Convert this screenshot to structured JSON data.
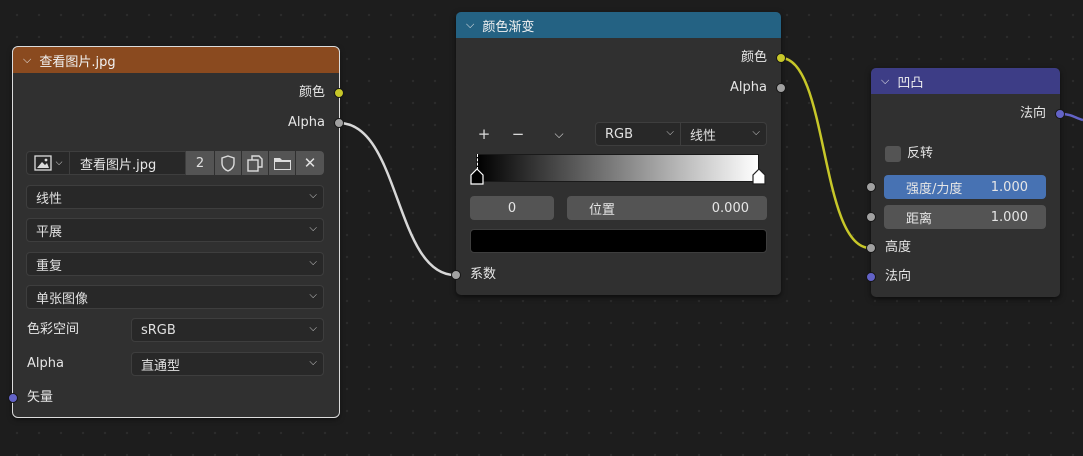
{
  "image_node": {
    "title": "查看图片.jpg",
    "outputs": [
      "颜色",
      "Alpha"
    ],
    "image_name": "查看图片.jpg",
    "user_count": "2",
    "interpolation": "线性",
    "projection": "平展",
    "extension": "重复",
    "source": "单张图像",
    "color_space_label": "色彩空间",
    "color_space_value": "sRGB",
    "alpha_label": "Alpha",
    "alpha_value": "直通型",
    "input_vector": "矢量"
  },
  "ramp_node": {
    "title": "颜色渐变",
    "outputs": [
      "颜色",
      "Alpha"
    ],
    "add_symbol": "+",
    "remove_symbol": "−",
    "mode": "RGB",
    "interpolation": "线性",
    "active_index": "0",
    "position_label": "位置",
    "position_value": "0.000",
    "input_fac": "系数"
  },
  "bump_node": {
    "title": "凹凸",
    "output_normal": "法向",
    "invert_label": "反转",
    "strength_label": "强度/力度",
    "strength_value": "1.000",
    "distance_label": "距离",
    "distance_value": "1.000",
    "input_height": "高度",
    "input_normal": "法向"
  },
  "colors": {
    "image_header": "#8a4a1f",
    "ramp_header": "#246283",
    "bump_header": "#3d3d86",
    "accent_field": "#4772b3",
    "socket_color": "#c7c729",
    "socket_float": "#a1a1a1",
    "socket_vector": "#6363c7"
  }
}
